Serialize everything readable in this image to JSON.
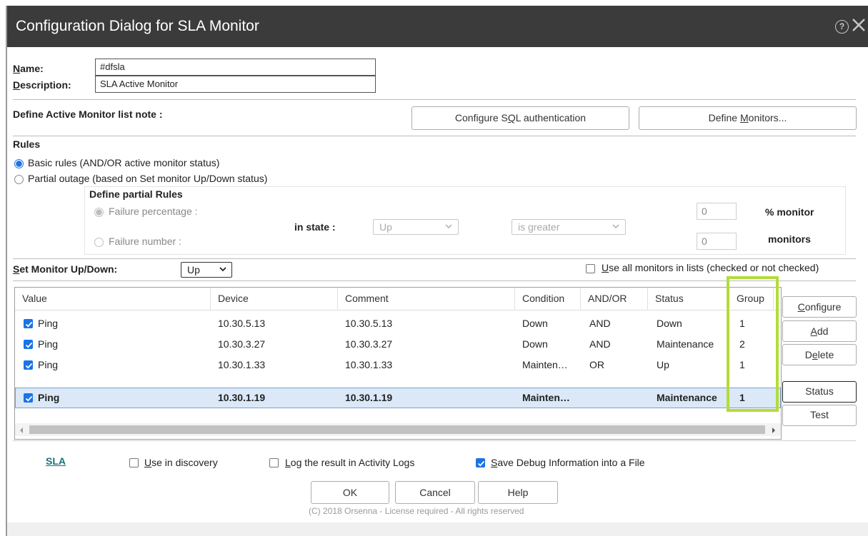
{
  "window": {
    "title": "Configuration Dialog for SLA Monitor",
    "help_icon": "?",
    "close_icon": "close-icon"
  },
  "form": {
    "name_label": "Name:",
    "name_value": "#dfsla",
    "description_label": "Description:",
    "description_value": "SLA Active Monitor",
    "note_label": "Define Active Monitor list note :",
    "configure_sql_button": "Configure SQL authentication",
    "define_monitors_button": "Define Monitors..."
  },
  "rules": {
    "title": "Rules",
    "basic_rules": "Basic rules (AND/OR active monitor status)",
    "partial_outage": "Partial outage (based on Set monitor Up/Down status)",
    "selected": "basic",
    "partial": {
      "title": "Define partial Rules",
      "failure_percentage": "Failure percentage :",
      "failure_number": "Failure number :",
      "in_state_label": "in state :",
      "state_value": "Up",
      "comparison_value": "is greater",
      "percentage_value": "0",
      "number_value": "0",
      "percent_unit": "% monitor",
      "number_unit": "monitors"
    }
  },
  "set_monitor": {
    "label": "Set Monitor Up/Down:",
    "value": "Up",
    "use_all_label": "Use all monitors in lists (checked or not checked)",
    "use_all_checked": false
  },
  "table": {
    "columns": [
      "Value",
      "Device",
      "Comment",
      "Condition",
      "AND/OR",
      "Status",
      "Group"
    ],
    "rows": [
      {
        "checked": true,
        "value": "Ping",
        "device": "10.30.5.13",
        "comment": "10.30.5.13",
        "condition": "Down",
        "andor": "AND",
        "status": "Down",
        "group": "1",
        "selected": false
      },
      {
        "checked": true,
        "value": "Ping",
        "device": "10.30.3.27",
        "comment": "10.30.3.27",
        "condition": "Down",
        "andor": "AND",
        "status": "Maintenance",
        "group": "2",
        "selected": false
      },
      {
        "checked": true,
        "value": "Ping",
        "device": "10.30.1.33",
        "comment": "10.30.1.33",
        "condition": "Mainten…",
        "andor": "OR",
        "status": "Up",
        "group": "1",
        "selected": false
      },
      {
        "checked": true,
        "value": "Ping",
        "device": "10.30.1.19",
        "comment": "10.30.1.19",
        "condition": "Mainten…",
        "andor": "",
        "status": "Maintenance",
        "group": "1",
        "selected": true
      }
    ]
  },
  "side_buttons": {
    "configure": "Configure",
    "add": "Add",
    "delete": "Delete",
    "status": "Status",
    "test": "Test"
  },
  "bottom": {
    "sla_link": "SLA",
    "use_in_discovery": "Use in discovery",
    "use_in_discovery_checked": false,
    "log_result": "Log the result in Activity Logs",
    "log_result_checked": false,
    "save_debug": "Save Debug Information into a File",
    "save_debug_checked": true,
    "ok": "OK",
    "cancel": "Cancel",
    "help": "Help",
    "copyright": "(C) 2018 Orsenna - License required - All rights reserved"
  },
  "colors": {
    "titlebar": "#3b3b3b",
    "accent": "#1a73e8",
    "highlight": "#b4db3a",
    "sla_link": "#1b6f7d"
  }
}
